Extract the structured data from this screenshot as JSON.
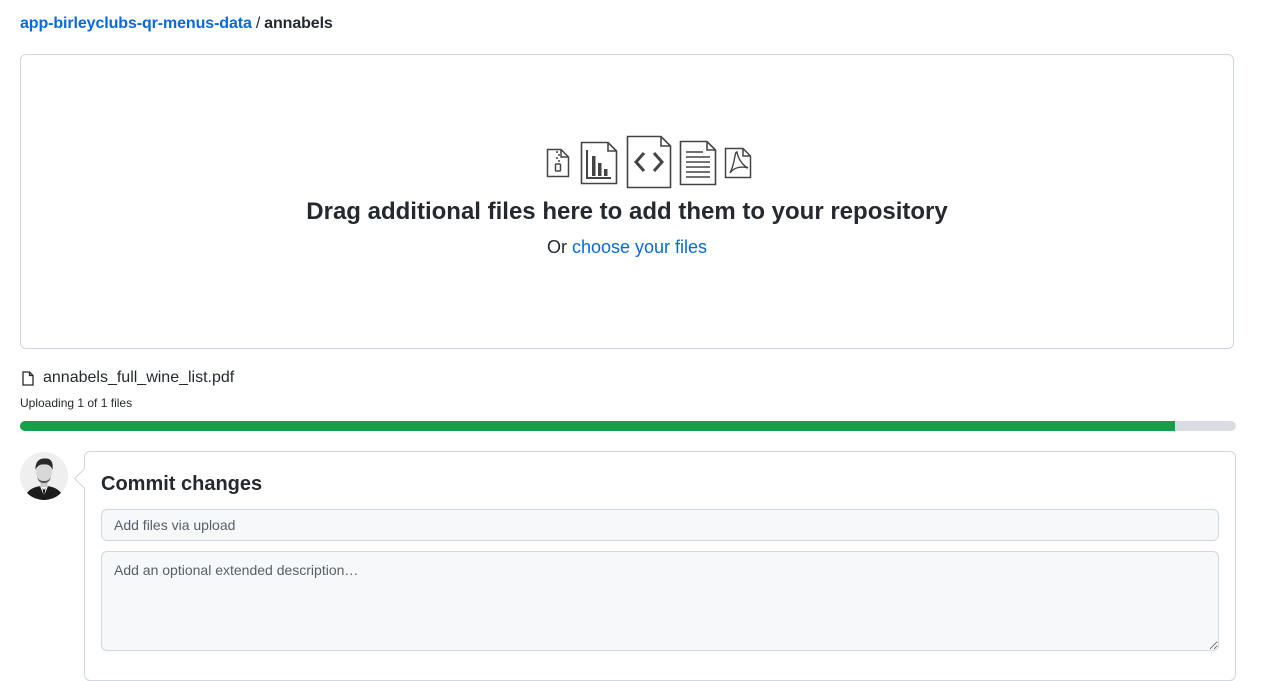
{
  "breadcrumb": {
    "repo": "app-birleyclubs-qr-menus-data",
    "separator": "/",
    "folder": "annabels"
  },
  "dropzone": {
    "icons": [
      "zip-file-icon",
      "chart-file-icon",
      "code-file-icon",
      "text-file-icon",
      "pdf-file-icon"
    ],
    "title": "Drag additional files here to add them to your repository",
    "prefix": "Or",
    "link": "choose your files"
  },
  "upload": {
    "file_name": "annabels_full_wine_list.pdf",
    "status": "Uploading 1 of 1 files",
    "progress": 0.95
  },
  "commit": {
    "title": "Commit changes",
    "summary_placeholder": "Add files via upload",
    "description_placeholder": "Add an optional extended description…"
  },
  "colors": {
    "link": "#0969da",
    "progress": "#12a04a",
    "progress_track": "#d8dde3",
    "border": "#d0d7de"
  }
}
